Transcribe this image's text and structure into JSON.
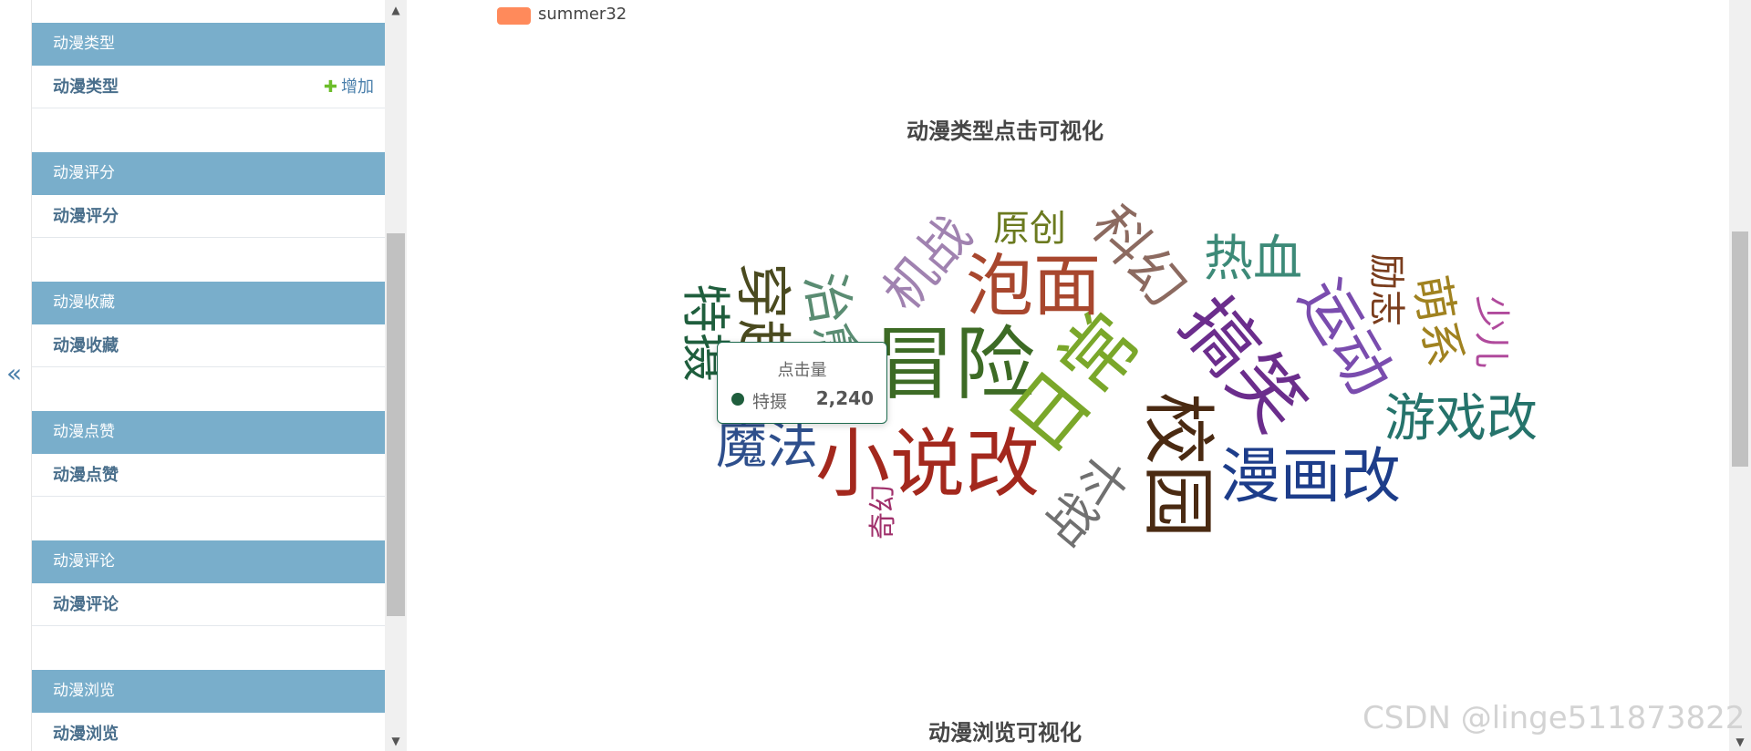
{
  "sidebar": {
    "collapse_icon": "«",
    "add_label": "增加",
    "groups": [
      {
        "header": "动漫类型",
        "item": "动漫类型",
        "has_add": true
      },
      {
        "header": "动漫评分",
        "item": "动漫评分"
      },
      {
        "header": "动漫收藏",
        "item": "动漫收藏"
      },
      {
        "header": "动漫点赞",
        "item": "动漫点赞"
      },
      {
        "header": "动漫评论",
        "item": "动漫评论"
      },
      {
        "header": "动漫浏览",
        "item": "动漫浏览"
      }
    ]
  },
  "legend": {
    "label": "summer32",
    "color": "#ff8a5b"
  },
  "chart_data": {
    "type": "wordcloud",
    "title": "动漫类型点击可视化",
    "words": [
      {
        "text": "冒险",
        "color": "#3d6b25"
      },
      {
        "text": "日常",
        "color": "#7aa72a"
      },
      {
        "text": "小说改",
        "color": "#a3281d"
      },
      {
        "text": "校园",
        "color": "#4a2a12"
      },
      {
        "text": "搞笑",
        "color": "#6b2d8c"
      },
      {
        "text": "泡面",
        "color": "#a8472e"
      },
      {
        "text": "漫画改",
        "color": "#1d3d8a"
      },
      {
        "text": "运动",
        "color": "#7a4cae"
      },
      {
        "text": "魔法",
        "color": "#2e4f8c"
      },
      {
        "text": "游戏改",
        "color": "#25736b"
      },
      {
        "text": "科幻",
        "color": "#8c6a60"
      },
      {
        "text": "特摄",
        "color": "#1f5e3d"
      },
      {
        "text": "穿越",
        "color": "#4a4a1f"
      },
      {
        "text": "治愈",
        "color": "#5a8c72"
      },
      {
        "text": "机战",
        "color": "#a082b0"
      },
      {
        "text": "热血",
        "color": "#3d8a78"
      },
      {
        "text": "战斗",
        "color": "#707070"
      },
      {
        "text": "萌系",
        "color": "#a08220"
      },
      {
        "text": "原创",
        "color": "#6b7a1f"
      },
      {
        "text": "励志",
        "color": "#7a3d1d"
      },
      {
        "text": "少儿",
        "color": "#b04a9c"
      },
      {
        "text": "奇幻",
        "color": "#a0306b"
      }
    ],
    "tooltip": {
      "series": "点击量",
      "name": "特摄",
      "value": "2,240"
    }
  },
  "next_chart_title": "动漫浏览可视化",
  "watermark": "CSDN @linge511873822"
}
